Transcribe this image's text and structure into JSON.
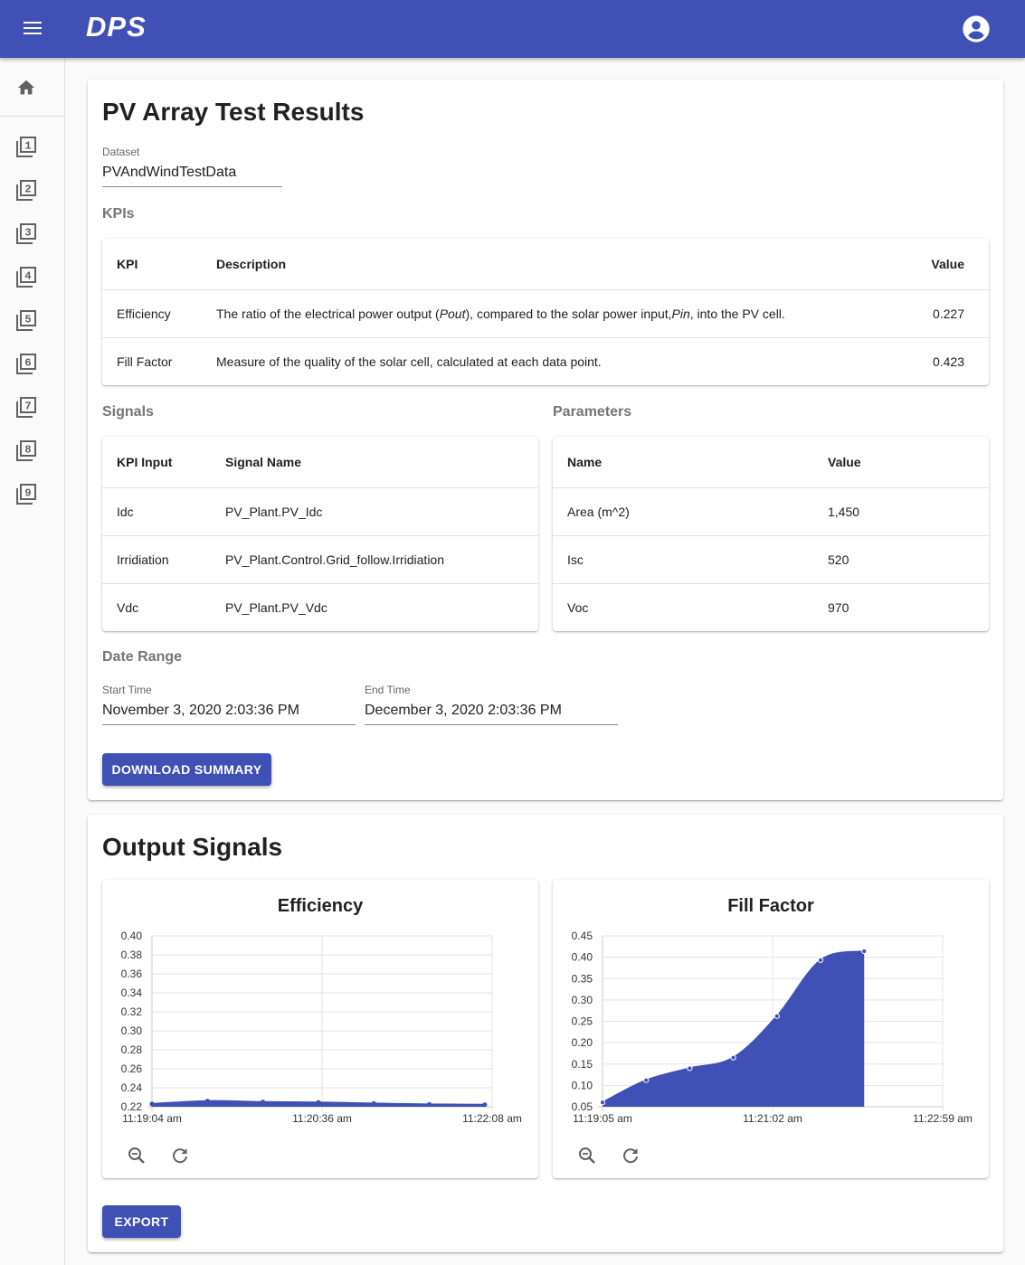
{
  "app": {
    "brand": "DPS"
  },
  "sidebar": {
    "items": [
      "1",
      "2",
      "3",
      "4",
      "5",
      "6",
      "7",
      "8",
      "9"
    ]
  },
  "summary": {
    "title": "PV Array Test Results",
    "dataset": {
      "label": "Dataset",
      "value": "PVAndWindTestData"
    },
    "kpis": {
      "heading": "KPIs",
      "headers": [
        "KPI",
        "Description",
        "Value"
      ],
      "rows": [
        {
          "kpi": "Efficiency",
          "desc_a": "The ratio of the electrical power output (",
          "desc_b": "Pout",
          "desc_c": "), compared to the solar power input, ",
          "desc_d": "Pin",
          "desc_e": ", into the PV cell.",
          "value": "0.227"
        },
        {
          "kpi": "Fill Factor",
          "desc_a": "Measure of the quality of the solar cell, calculated at each data point.",
          "value": "0.423"
        }
      ]
    },
    "signals": {
      "heading": "Signals",
      "headers": [
        "KPI Input",
        "Signal Name"
      ],
      "rows": [
        {
          "input": "Idc",
          "name": "PV_Plant.PV_Idc"
        },
        {
          "input": "Irridiation",
          "name": "PV_Plant.Control.Grid_follow.Irridiation"
        },
        {
          "input": "Vdc",
          "name": "PV_Plant.PV_Vdc"
        }
      ]
    },
    "parameters": {
      "heading": "Parameters",
      "headers": [
        "Name",
        "Value"
      ],
      "rows": [
        {
          "name": "Area (m^2)",
          "value": "1,450"
        },
        {
          "name": "Isc",
          "value": "520"
        },
        {
          "name": "Voc",
          "value": "970"
        }
      ]
    },
    "date_range": {
      "heading": "Date Range",
      "start_label": "Start Time",
      "start_value": "November 3, 2020 2:03:36 PM",
      "end_label": "End Time",
      "end_value": "December 3, 2020 2:03:36 PM"
    },
    "download_label": "DOWNLOAD SUMMARY"
  },
  "output": {
    "title": "Output Signals",
    "export_label": "EXPORT"
  },
  "chart_data": [
    {
      "type": "line",
      "title": "Efficiency",
      "x": [
        "11:19:04",
        "11:19:34",
        "11:20:04",
        "11:20:34",
        "11:21:04",
        "11:21:34",
        "11:22:04"
      ],
      "x_ticks": [
        "11:19:04 am",
        "11:20:36 am",
        "11:22:08 am"
      ],
      "x_range": [
        0,
        184
      ],
      "series": [
        {
          "values": [
            0.223,
            0.226,
            0.225,
            0.2245,
            0.2235,
            0.2225,
            0.2222
          ]
        }
      ],
      "y_ticks": [
        "0.40",
        "0.38",
        "0.36",
        "0.34",
        "0.32",
        "0.30",
        "0.28",
        "0.26",
        "0.24",
        "0.22"
      ],
      "ylim": [
        0.22,
        0.4
      ],
      "grid": true,
      "color": "#3f51b5"
    },
    {
      "type": "area",
      "title": "Fill Factor",
      "x": [
        "11:19:05",
        "11:19:35",
        "11:20:05",
        "11:20:35",
        "11:21:05",
        "11:21:35",
        "11:22:05"
      ],
      "x_ticks": [
        "11:19:05 am",
        "11:21:02 am",
        "11:22:59 am"
      ],
      "x_range": [
        0,
        234
      ],
      "series": [
        {
          "values": [
            0.06,
            0.112,
            0.14,
            0.165,
            0.262,
            0.393,
            0.414
          ]
        }
      ],
      "y_ticks": [
        "0.45",
        "0.40",
        "0.35",
        "0.30",
        "0.25",
        "0.20",
        "0.15",
        "0.10",
        "0.05"
      ],
      "ylim": [
        0.05,
        0.45
      ],
      "grid": true,
      "color": "#3f51b5"
    }
  ]
}
